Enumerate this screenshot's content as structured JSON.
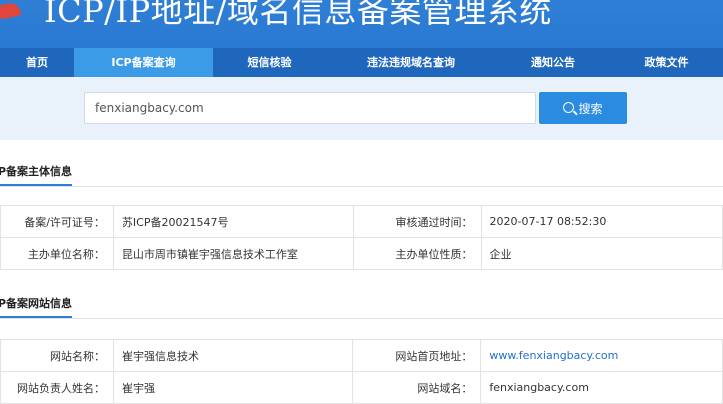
{
  "header": {
    "title": "ICP/IP地址/域名信息备案管理系统"
  },
  "nav": {
    "items": [
      {
        "label": "首页",
        "active": false
      },
      {
        "label": "ICP备案查询",
        "active": true
      },
      {
        "label": "短信核验",
        "active": false
      },
      {
        "label": "违法违规域名查询",
        "active": false
      },
      {
        "label": "通知公告",
        "active": false
      },
      {
        "label": "政策文件",
        "active": false
      }
    ]
  },
  "search": {
    "value": "fenxiangbacy.com",
    "button_label": "搜索"
  },
  "subject_section": {
    "heading": "P备案主体信息",
    "rows": [
      {
        "label1": "备案/许可证号：",
        "value1": "苏ICP备20021547号",
        "label2": "审核通过时间：",
        "value2": "2020-07-17 08:52:30"
      },
      {
        "label1": "主办单位名称：",
        "value1": "昆山市周市镇崔宇强信息技术工作室",
        "label2": "主办单位性质：",
        "value2": "企业"
      }
    ]
  },
  "website_section": {
    "heading": "P备案网站信息",
    "rows": [
      {
        "label1": "网站名称：",
        "value1": "崔宇强信息技术",
        "label2": "网站首页地址：",
        "value2": "www.fenxiangbacy.com"
      },
      {
        "label1": "网站负责人姓名：",
        "value1": "崔宇强",
        "label2": "网站域名：",
        "value2": "fenxiangbacy.com"
      }
    ]
  },
  "colors": {
    "banner": "#2f7fd6",
    "nav": "#1f66bd",
    "nav_active": "#3b9be6",
    "search_bg": "#e9f2fb",
    "accent": "#2b8be0",
    "link": "#1f6fcf"
  }
}
